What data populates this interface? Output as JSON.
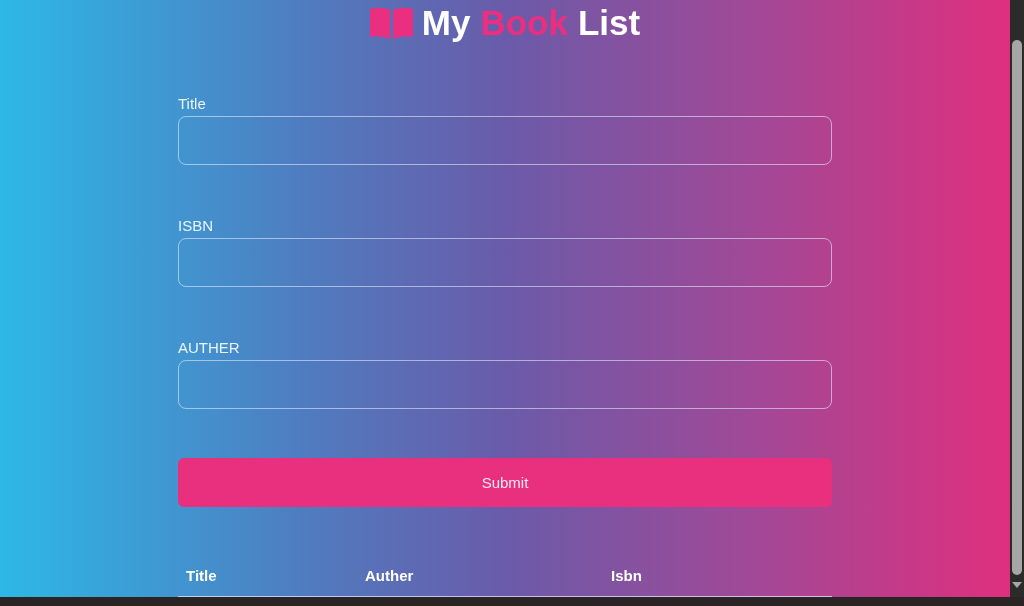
{
  "header": {
    "title_parts": [
      {
        "text": "My",
        "accent": false
      },
      {
        "text": "Book",
        "accent": true
      },
      {
        "text": "List",
        "accent": false
      }
    ]
  },
  "form": {
    "fields": [
      {
        "label": "Title"
      },
      {
        "label": "ISBN"
      },
      {
        "label": "AUTHER"
      }
    ],
    "submit": "Submit"
  },
  "table": {
    "columns": [
      "Title",
      "Auther",
      "Isbn"
    ]
  }
}
